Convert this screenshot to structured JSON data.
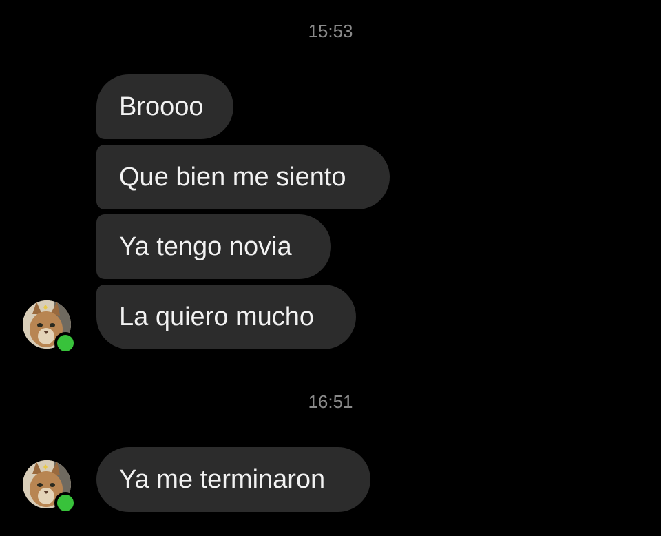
{
  "conversation": {
    "groups": [
      {
        "timestamp": "15:53",
        "messages": [
          "Broooo",
          "Que bien me siento",
          "Ya tengo novia",
          "La quiero mucho"
        ]
      },
      {
        "timestamp": "16:51",
        "messages": [
          "Ya me terminaron"
        ]
      }
    ]
  },
  "colors": {
    "background": "#000000",
    "bubble": "#2c2c2c",
    "text": "#f2f2f2",
    "timestamp": "#8a8a8a",
    "online_status": "#38c23b"
  },
  "icons": {
    "avatar": "caracal-cat-avatar",
    "status": "online-dot-icon"
  }
}
